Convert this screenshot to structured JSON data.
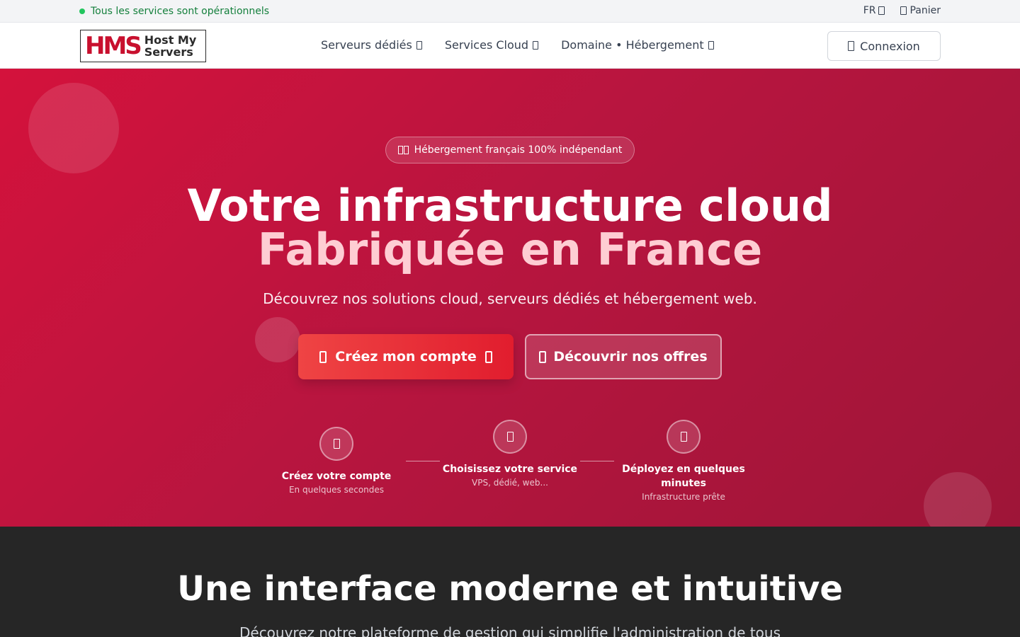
{
  "topbar": {
    "status_text": "Tous les services sont opérationnels",
    "language": "FR",
    "cart": "Panier"
  },
  "header": {
    "logo_mark": "HMS",
    "logo_line1": "Host My",
    "logo_line2": "Servers",
    "nav": [
      {
        "label": "Serveurs dédiés"
      },
      {
        "label": "Services Cloud"
      },
      {
        "label": "Domaine • Hébergement"
      }
    ],
    "login_label": "Connexion"
  },
  "hero": {
    "badge": "Hébergement français 100% indépendant",
    "title_line1": "Votre infrastructure cloud",
    "title_line2": "Fabriquée en France",
    "subtitle": "Découvrez nos solutions cloud, serveurs dédiés et hébergement web.",
    "cta_primary": "Créez mon compte",
    "cta_secondary": "Découvrir nos offres",
    "steps": [
      {
        "title": "Créez votre compte",
        "desc": "En quelques secondes"
      },
      {
        "title": "Choisissez votre service",
        "desc": "VPS, dédié, web..."
      },
      {
        "title": "Déployez en quelques minutes",
        "desc": "Infrastructure prête"
      }
    ]
  },
  "section2": {
    "title": "Une interface moderne et intuitive",
    "subtitle": "Découvrez notre plateforme de gestion qui simplifie l'administration de tous"
  },
  "colors": {
    "brand_red": "#c8102e",
    "hero_start": "#d4123c",
    "hero_end": "#9e1538",
    "accent_pink": "#fecdd3",
    "status_green": "#22c55e",
    "dark_bg": "#262626"
  },
  "icons": {
    "status": "status-dot-icon",
    "language": "chevron-down-icon",
    "cart": "cart-icon",
    "login": "user-icon",
    "badge": "flag-fr-icon",
    "cta_primary_left": "user-plus-icon",
    "cta_primary_right": "arrow-right-icon",
    "cta_secondary": "grid-icon",
    "step1": "user-icon",
    "step2": "server-icon",
    "step3": "rocket-icon"
  }
}
